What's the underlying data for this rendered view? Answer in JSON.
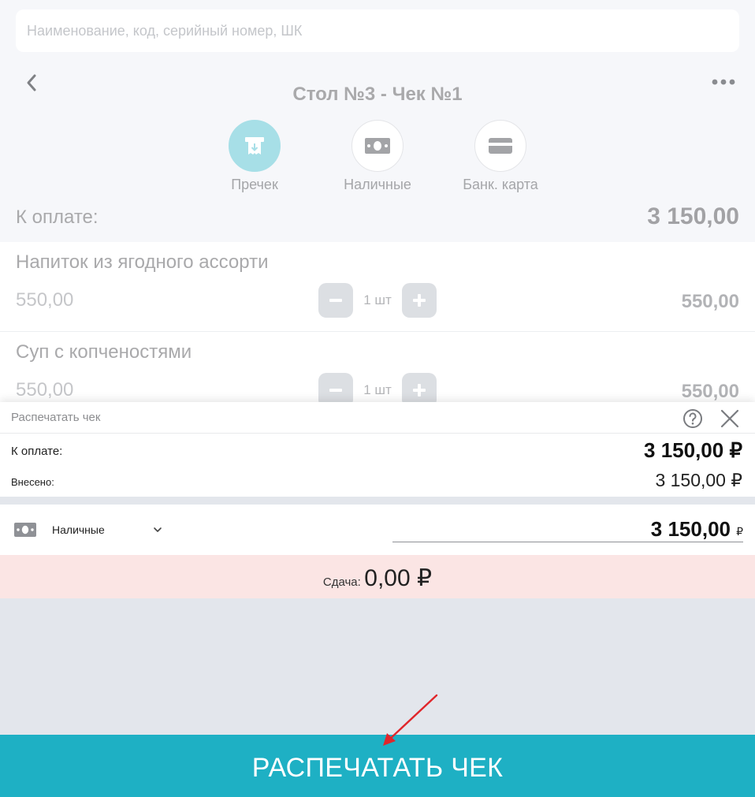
{
  "search": {
    "placeholder": "Наименование, код, серийный номер, ШК"
  },
  "order": {
    "title": "Стол №3 - Чек №1"
  },
  "payment_methods": [
    {
      "label": "Пречек",
      "icon": "precheck-icon",
      "active": true
    },
    {
      "label": "Наличные",
      "icon": "cash-icon",
      "active": false
    },
    {
      "label": "Банк. карта",
      "icon": "bank-card-icon",
      "active": false
    }
  ],
  "total": {
    "label": "К оплате:",
    "value": "3 150,00"
  },
  "items": [
    {
      "name": "Напиток из ягодного ассорти",
      "price": "550,00",
      "qty": "1 шт",
      "sum": "550,00"
    },
    {
      "name": "Суп с копченостями",
      "price": "550,00",
      "qty": "1 шт",
      "sum": "550,00"
    }
  ],
  "dialog": {
    "title": "Распечатать чек",
    "due_label": "К оплате:",
    "due_value": "3 150,00 ₽",
    "paid_label": "Внесено:",
    "paid_value": "3 150,00 ₽",
    "payment": {
      "method": "Наличные",
      "amount": "3 150,00",
      "currency": "₽"
    },
    "change_label": "Сдача:",
    "change_value": "0,00 ₽",
    "print_button": "РАСПЕЧАТАТЬ ЧЕК"
  },
  "colors": {
    "accent": "#1eb0c4",
    "precheck_active": "#a7dfe7",
    "change_bg": "#fbe5e4",
    "annotation_arrow": "#e0262b"
  }
}
